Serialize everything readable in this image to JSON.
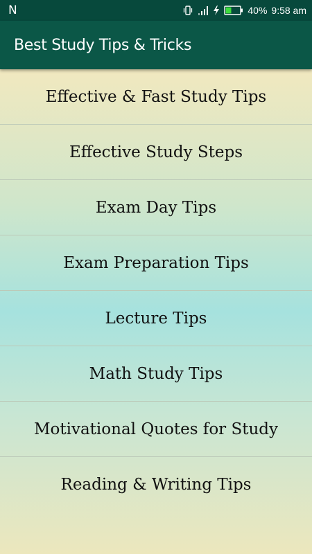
{
  "status_bar": {
    "carrier_glyph": "N",
    "battery_percent": "40%",
    "time": "9:58 am",
    "icons": [
      "vibrate-icon",
      "signal-icon",
      "charging-icon",
      "battery-icon"
    ]
  },
  "app_bar": {
    "title": "Best Study Tips & Tricks"
  },
  "menu": {
    "items": [
      {
        "label": "Effective & Fast Study Tips"
      },
      {
        "label": "Effective Study Steps"
      },
      {
        "label": "Exam Day Tips"
      },
      {
        "label": "Exam Preparation Tips"
      },
      {
        "label": "Lecture Tips"
      },
      {
        "label": "Math Study Tips"
      },
      {
        "label": "Motivational Quotes for Study"
      },
      {
        "label": "Reading & Writing Tips"
      }
    ]
  },
  "colors": {
    "status_bar": "#07493c",
    "app_bar": "#0b5747",
    "battery_fill": "#3ddc3d"
  },
  "battery_level": 0.4
}
